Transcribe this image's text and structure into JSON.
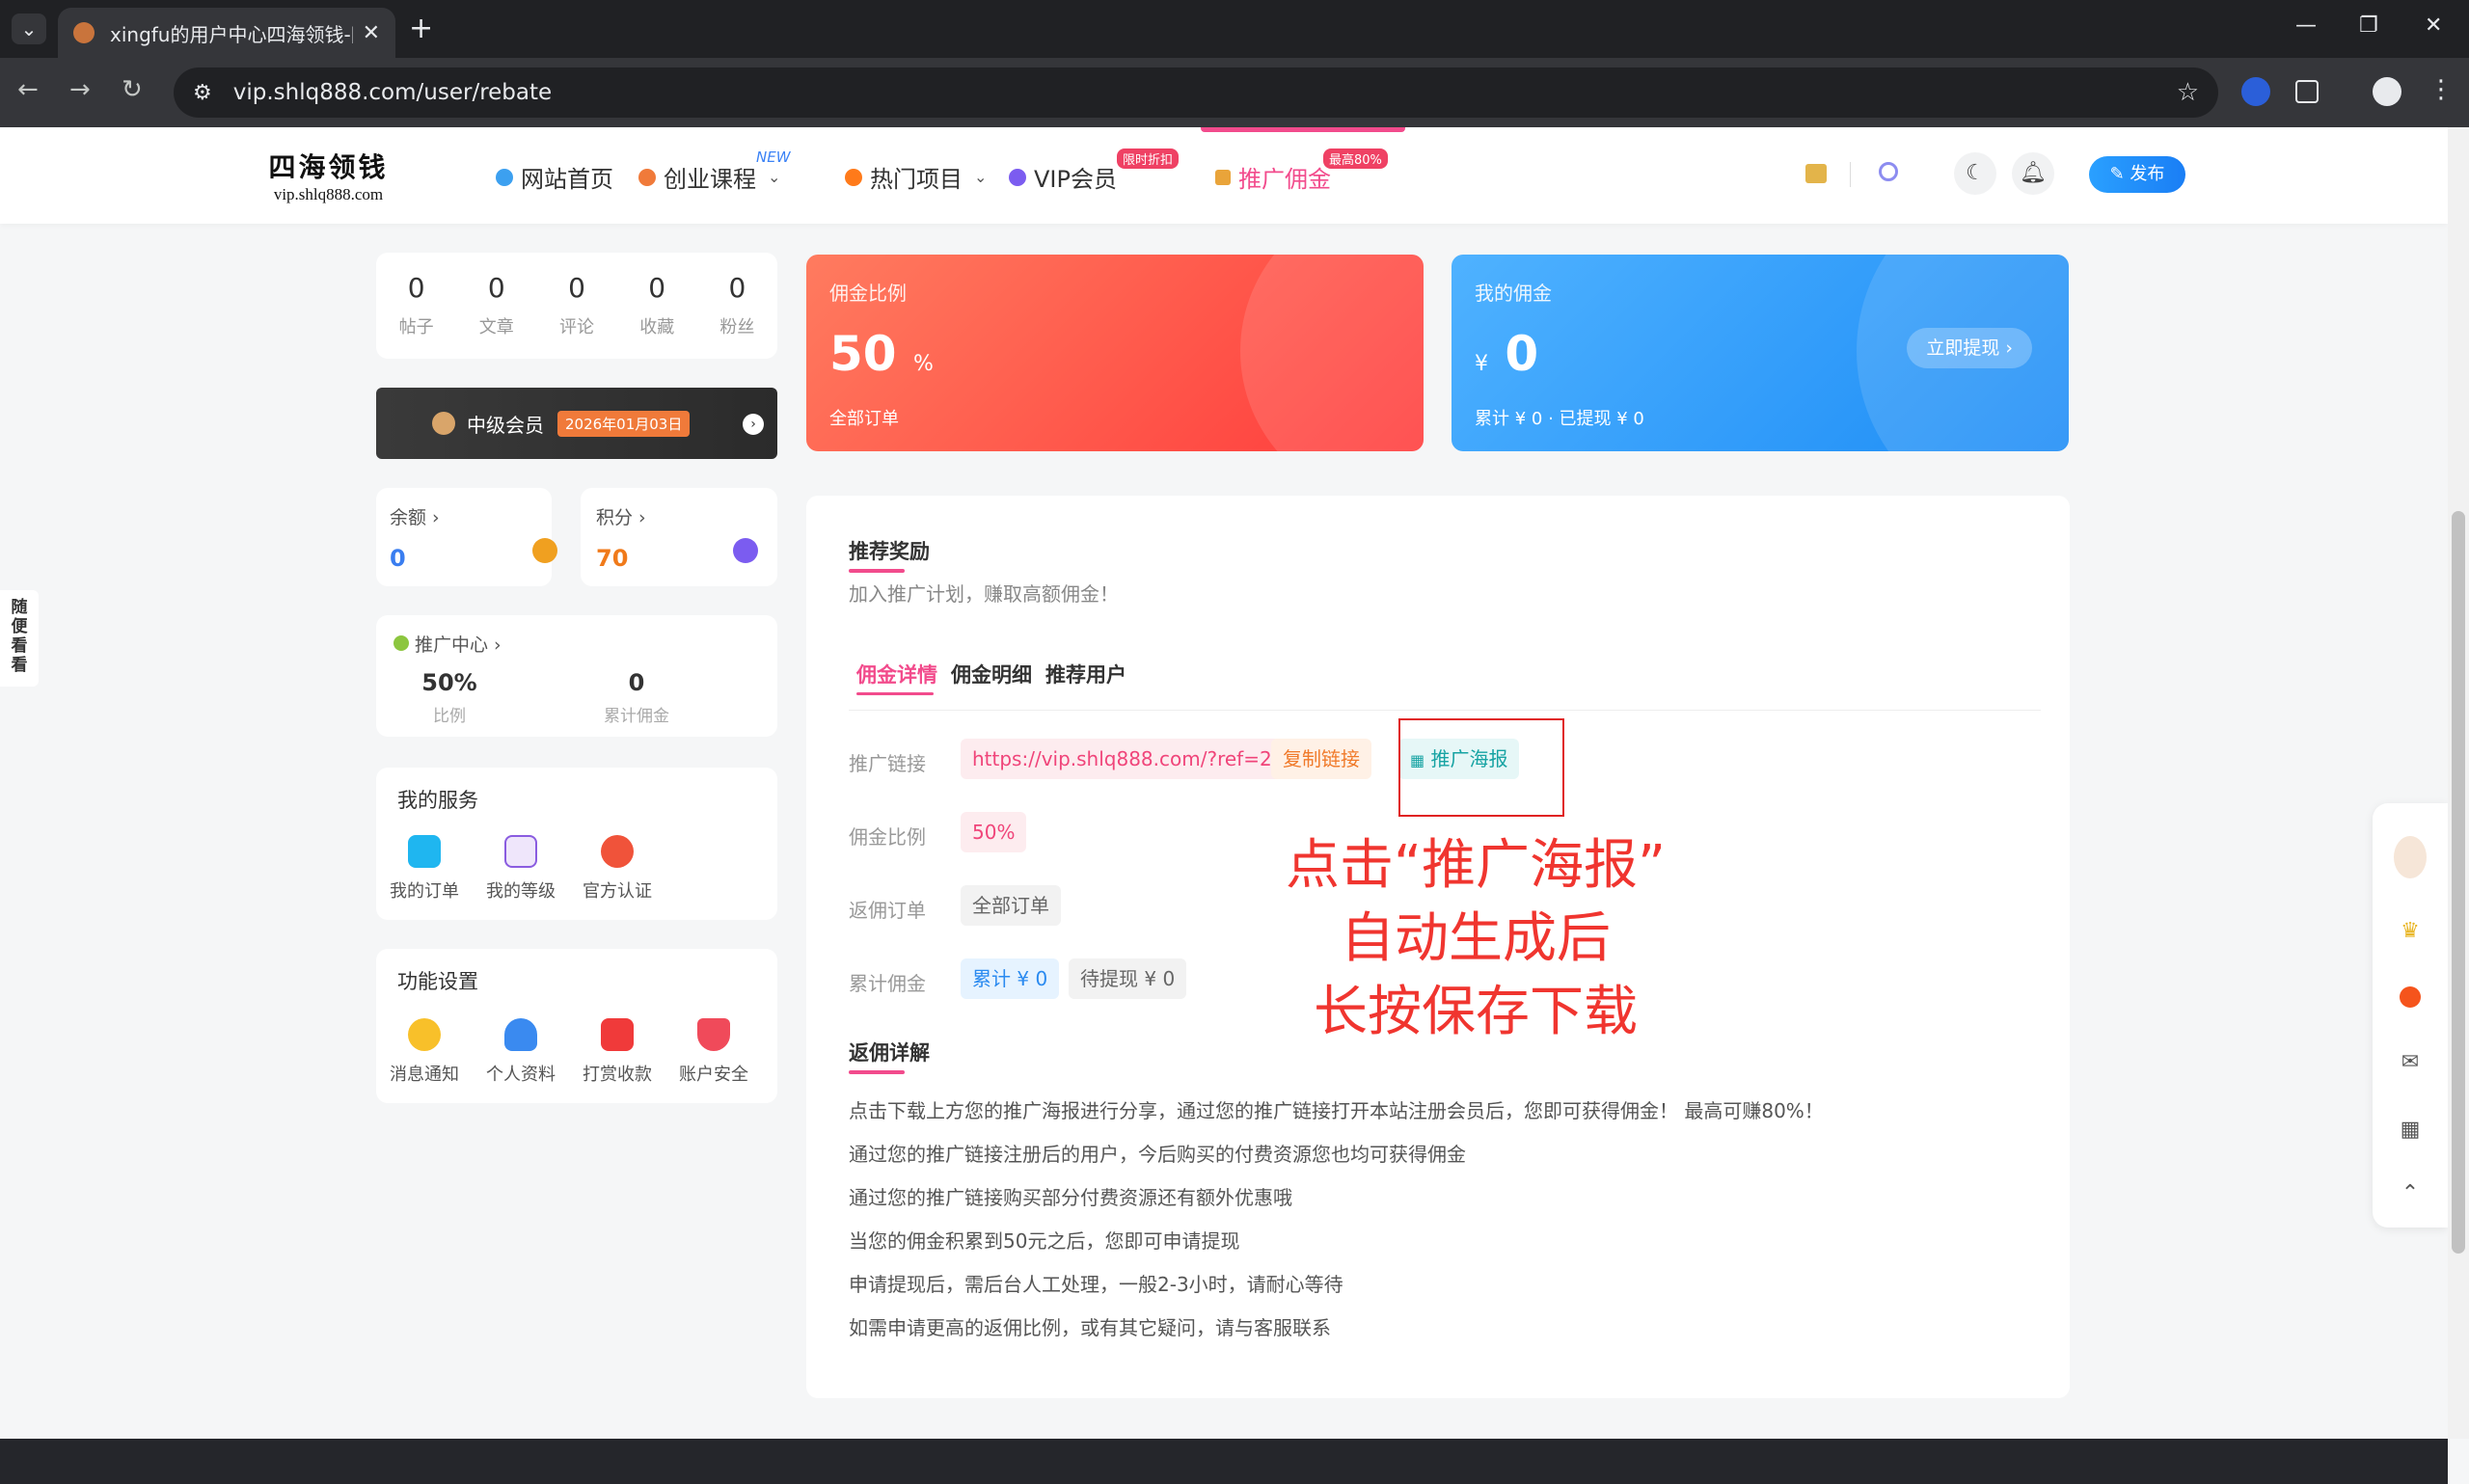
{
  "browser": {
    "tab_title": "xingfu的用户中心四海领钱-网创",
    "tab_close": "✕",
    "new_tab": "+",
    "url": "vip.shlq888.com/user/rebate"
  },
  "header": {
    "logo_text": "四海领钱",
    "logo_domain": "vip.shlq888.com",
    "nav": [
      {
        "label": "网站首页"
      },
      {
        "label": "创业课程",
        "tag": "NEW"
      },
      {
        "label": "热门项目"
      },
      {
        "label": "VIP会员",
        "tag": "限时折扣"
      },
      {
        "label": "推广佣金",
        "tag": "最高80%"
      }
    ],
    "publish_label": "发布"
  },
  "profile": {
    "stats": [
      {
        "value": "0",
        "label": "帖子"
      },
      {
        "value": "0",
        "label": "文章"
      },
      {
        "value": "0",
        "label": "评论"
      },
      {
        "value": "0",
        "label": "收藏"
      },
      {
        "value": "0",
        "label": "粉丝"
      }
    ],
    "vip_level": "中级会员",
    "vip_expiry": "2026年01月03日",
    "balance_label": "余额",
    "balance_value": "0",
    "points_label": "积分",
    "points_value": "70",
    "promo_label": "推广中心",
    "promo_ratio": "50%",
    "promo_ratio_label": "比例",
    "promo_total": "0",
    "promo_total_label": "累计佣金"
  },
  "services": {
    "title": "我的服务",
    "items": [
      "我的订单",
      "我的等级",
      "官方认证"
    ]
  },
  "settings": {
    "title": "功能设置",
    "items": [
      "消息通知",
      "个人资料",
      "打赏收款",
      "账户安全"
    ]
  },
  "commission_card": {
    "title": "佣金比例",
    "value": "50",
    "unit": "%",
    "sub": "全部订单"
  },
  "mine_card": {
    "title": "我的佣金",
    "currency": "¥",
    "value": "0",
    "withdraw_btn": "立即提现 ›",
    "summary": "累计 ¥ 0 · 已提现 ¥ 0"
  },
  "main": {
    "title": "推荐奖励",
    "subtitle": "加入推广计划，赚取高额佣金！",
    "tabs": [
      "佣金详情",
      "佣金明细",
      "推荐用户"
    ],
    "rows": [
      {
        "label": "推广链接"
      },
      {
        "label": "佣金比例"
      },
      {
        "label": "返佣订单"
      },
      {
        "label": "累计佣金"
      }
    ],
    "link": "https://vip.shlq888.com/?ref=2",
    "copy_btn": "复制链接",
    "poster_btn": "推广海报",
    "ratio_chip": "50%",
    "orders_chip": "全部订单",
    "total_chip": "累计 ¥ 0",
    "pending_chip": "待提现 ¥ 0",
    "rules_title": "返佣详解",
    "rules": [
      "点击下载上方您的推广海报进行分享，通过您的推广链接打开本站注册会员后，您即可获得佣金！ 最高可赚80%！",
      "通过您的推广链接注册后的用户，今后购买的付费资源您也均可获得佣金",
      "通过您的推广链接购买部分付费资源还有额外优惠哦",
      "当您的佣金积累到50元之后，您即可申请提现",
      "申请提现后，需后台人工处理，一般2-3小时，请耐心等待",
      "如需申请更高的返佣比例，或有其它疑问，请与客服联系"
    ]
  },
  "annotation": [
    "点击“推广海报”",
    "自动生成后",
    "长按保存下载"
  ],
  "side_tab": "随便看看",
  "colors": {
    "accent_pink": "#f24b8c",
    "red": "#ff3b3b",
    "blue": "#1c8cf6"
  }
}
